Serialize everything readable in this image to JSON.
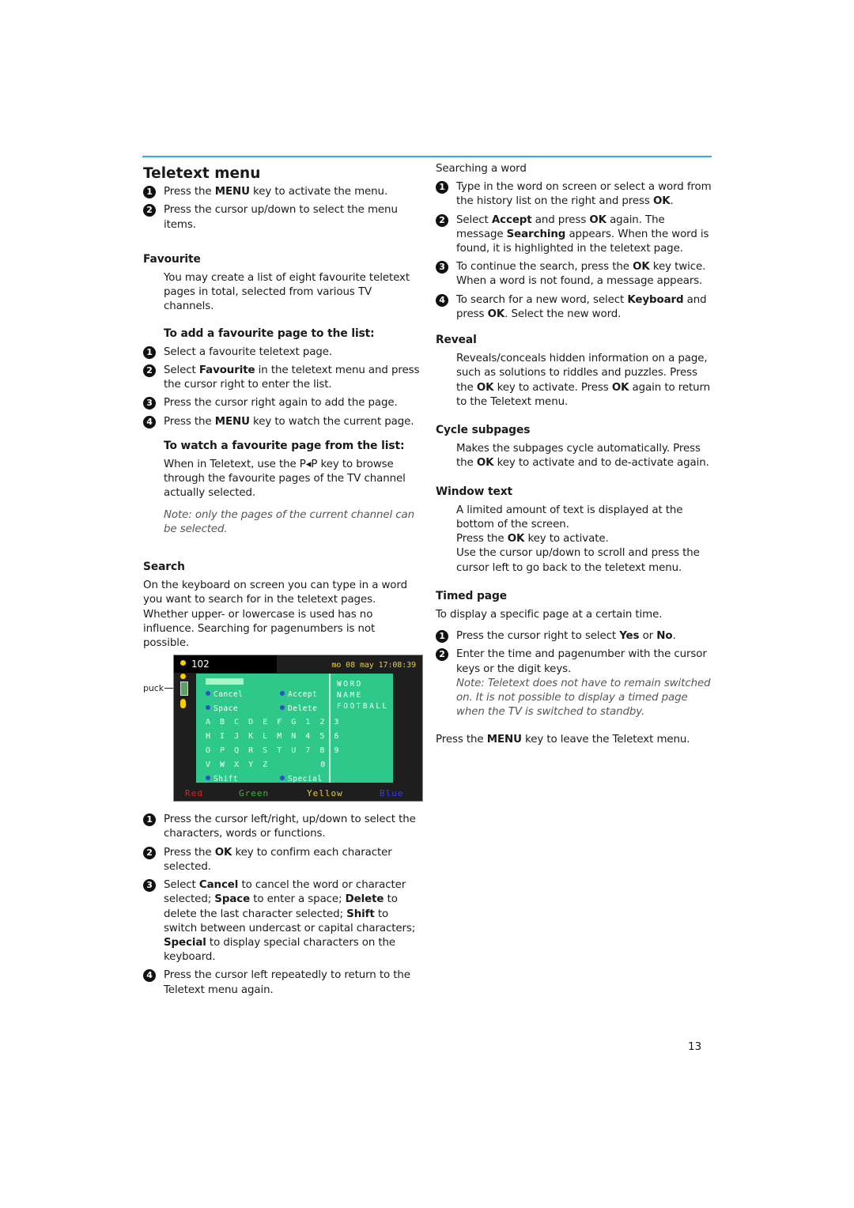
{
  "page": {
    "number": "13"
  },
  "left": {
    "title": "Teletext menu",
    "intro_steps": [
      {
        "num": "1",
        "pre": "Press the ",
        "bold": "MENU",
        "post": " key to activate the menu."
      },
      {
        "num": "2",
        "text": "Press the cursor up/down to select the menu items."
      }
    ],
    "favourite": {
      "heading": "Favourite",
      "body": "You may create a list of eight favourite teletext pages in total, selected from various TV channels.",
      "add_heading": "To add a favourite page to the list:",
      "add_steps": [
        {
          "num": "1",
          "text": "Select a favourite teletext page."
        },
        {
          "num": "2",
          "pre": "Select ",
          "bold": "Favourite",
          "post": " in the teletext menu and press the cursor right to enter the list."
        },
        {
          "num": "3",
          "text": "Press the cursor right again to add the page."
        },
        {
          "num": "4",
          "pre": "Press the ",
          "bold": "MENU",
          "post": " key to watch the current page."
        }
      ],
      "watch_heading": "To watch a favourite page from the list:",
      "watch_body": "When in Teletext, use the P◂P key to browse through the favourite pages of the TV channel actually selected.",
      "note": "Note: only the pages of the current channel can be selected."
    },
    "search": {
      "heading": "Search",
      "body": "On the keyboard on screen you can type in a word you want to search for in the teletext pages. Whether upper- or lowercase is used has no influence. Searching for pagenumbers is not possible.",
      "steps": [
        {
          "num": "1",
          "text": "Press the cursor left/right, up/down to select the characters, words or functions."
        },
        {
          "num": "2",
          "pre": "Press the ",
          "bold": "OK",
          "post": " key to confirm each character selected."
        },
        {
          "num": "3",
          "parts": [
            {
              "t": "Select ",
              "b": false
            },
            {
              "t": "Cancel",
              "b": true
            },
            {
              "t": " to cancel the word or character selected; ",
              "b": false
            },
            {
              "t": "Space",
              "b": true
            },
            {
              "t": " to enter a space;  ",
              "b": false
            },
            {
              "t": "Delete",
              "b": true
            },
            {
              "t": " to delete the last character selected; ",
              "b": false
            },
            {
              "t": "Shift",
              "b": true
            },
            {
              "t": " to switch between undercast or capital characters; ",
              "b": false
            },
            {
              "t": "Special",
              "b": true
            },
            {
              "t": " to display special characters on the keyboard.",
              "b": false
            }
          ]
        },
        {
          "num": "4",
          "text": "Press the cursor left repeatedly to return to the Teletext menu again."
        }
      ]
    }
  },
  "tv": {
    "puck_label": "puck",
    "page_number": "102",
    "clock": "mo 08 may 17:08:39",
    "functions": {
      "cancel": "Cancel",
      "accept": "Accept",
      "space": "Space",
      "delete": "Delete",
      "shift": "Shift",
      "special": "Special"
    },
    "keyboard_rows": [
      "A B C D E F G  1 2 3",
      "H I J K L M N  4 5 6",
      "O P Q R S T U  7 8 9",
      "V W X Y Z      0"
    ],
    "history": [
      "WORD",
      "NAME",
      "FOOTBALL"
    ],
    "fastext": [
      {
        "label": "Red",
        "color": "#e02020"
      },
      {
        "label": "Green",
        "color": "#30c030"
      },
      {
        "label": "Yellow",
        "color": "#e8d020"
      },
      {
        "label": "Blue",
        "color": "#3c3cf0"
      }
    ],
    "colors": {
      "panel": "#2ec98a",
      "indicator": "#f2d000"
    }
  },
  "right": {
    "searching_heading": "Searching a word",
    "searching_steps": [
      {
        "num": "1",
        "parts": [
          {
            "t": "Type in the word on screen or select a word from the history list on the right and press ",
            "b": false
          },
          {
            "t": "OK",
            "b": true
          },
          {
            "t": ".",
            "b": false
          }
        ]
      },
      {
        "num": "2",
        "parts": [
          {
            "t": "Select ",
            "b": false
          },
          {
            "t": "Accept",
            "b": true
          },
          {
            "t": " and press ",
            "b": false
          },
          {
            "t": "OK",
            "b": true
          },
          {
            "t": " again. The message ",
            "b": false
          },
          {
            "t": "Searching",
            "b": true
          },
          {
            "t": " appears. When the word is found, it is highlighted in the teletext page.",
            "b": false
          }
        ]
      },
      {
        "num": "3",
        "parts": [
          {
            "t": "To continue the search, press the ",
            "b": false
          },
          {
            "t": "OK",
            "b": true
          },
          {
            "t": " key twice. When a word is not found, a message appears.",
            "b": false
          }
        ]
      },
      {
        "num": "4",
        "parts": [
          {
            "t": "To search for a new word, select ",
            "b": false
          },
          {
            "t": "Keyboard",
            "b": true
          },
          {
            "t": " and press ",
            "b": false
          },
          {
            "t": "OK",
            "b": true
          },
          {
            "t": ". Select the new word.",
            "b": false
          }
        ]
      }
    ],
    "reveal": {
      "heading": "Reveal",
      "parts": [
        {
          "t": "Reveals/conceals hidden information on a page, such as solutions to riddles and puzzles. Press the ",
          "b": false
        },
        {
          "t": "OK",
          "b": true
        },
        {
          "t": " key to activate. Press ",
          "b": false
        },
        {
          "t": "OK",
          "b": true
        },
        {
          "t": " again to return to the Teletext menu.",
          "b": false
        }
      ]
    },
    "cycle": {
      "heading": "Cycle subpages",
      "parts": [
        {
          "t": "Makes the subpages cycle automatically. Press the ",
          "b": false
        },
        {
          "t": "OK",
          "b": true
        },
        {
          "t": " key to activate and to de-activate again.",
          "b": false
        }
      ]
    },
    "window": {
      "heading": "Window text",
      "line1": "A limited amount of text is displayed at the bottom of the screen.",
      "line2_pre": "Press the ",
      "line2_bold": "OK",
      "line2_post": " key to activate.",
      "line3": "Use the cursor up/down to scroll and press the cursor left to go back to the teletext menu."
    },
    "timed": {
      "heading": "Timed page",
      "body": "To display a specific page at a certain time.",
      "steps": [
        {
          "num": "1",
          "parts": [
            {
              "t": "Press the cursor right to select ",
              "b": false
            },
            {
              "t": "Yes",
              "b": true
            },
            {
              "t": " or ",
              "b": false
            },
            {
              "t": "No",
              "b": true
            },
            {
              "t": ".",
              "b": false
            }
          ]
        },
        {
          "num": "2",
          "parts": [
            {
              "t": "Enter the time and pagenumber with the cursor keys or the digit keys.",
              "b": false
            }
          ]
        }
      ],
      "note": "Note: Teletext does not have to remain switched on. It is not possible to display a timed page when the TV is switched to standby."
    },
    "closing": {
      "pre": "Press the ",
      "bold": "MENU",
      "post": " key to leave the Teletext menu."
    }
  }
}
